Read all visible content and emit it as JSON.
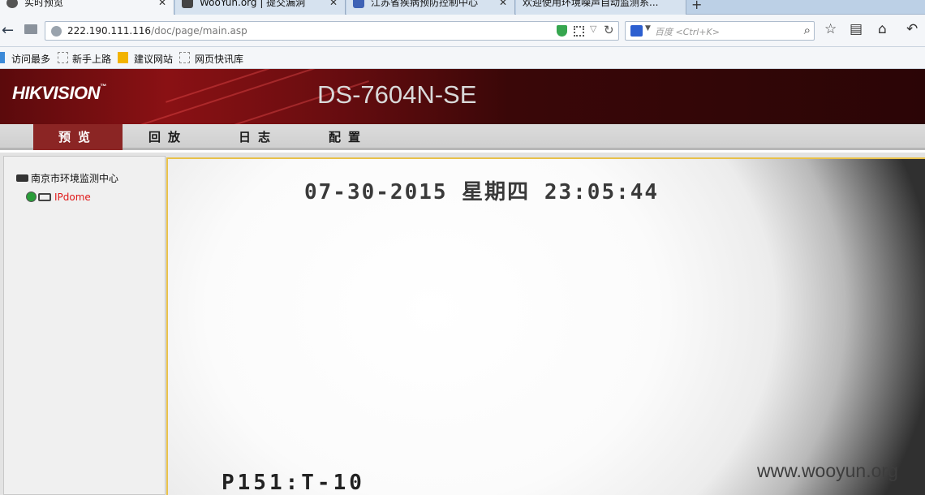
{
  "browser": {
    "tabs": [
      {
        "label": "实时预览",
        "active": true,
        "icon": "camera-icon"
      },
      {
        "label": "WooYun.org | 提交漏洞",
        "active": false,
        "icon": "wooyun-icon"
      },
      {
        "label": "江苏省疾病预防控制中心",
        "active": false,
        "icon": "td-icon"
      },
      {
        "label": "欢迎使用环境噪声自动监测系...",
        "active": false,
        "icon": "none"
      }
    ],
    "url": {
      "host": "222.190.111.116",
      "path": "/doc/page/main.asp"
    },
    "search_placeholder": "百度 <Ctrl+K>",
    "bookmarks": [
      "访问最多",
      "新手上路",
      "建议网站",
      "网页快讯库"
    ]
  },
  "app": {
    "logo": "HIKVISION",
    "model": "DS-7604N-SE",
    "menu": [
      "预览",
      "回放",
      "日志",
      "配置"
    ],
    "active_menu": "预览",
    "tree": {
      "root": "南京市环境监测中心",
      "camera": "IPdome"
    }
  },
  "video": {
    "osd_time": "07-30-2015 星期四 23:05:44",
    "osd_bottom": "P151:T-10"
  },
  "watermark": "www.wooyun.org",
  "colors": {
    "accent": "#8b2524",
    "camera_label": "#e01818",
    "banner": "#5b0a0c"
  }
}
